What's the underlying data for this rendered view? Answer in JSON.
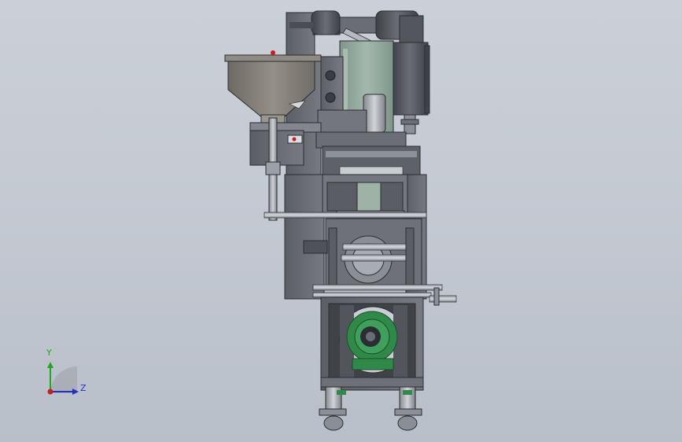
{
  "app": {
    "view": "cad-3d-viewport"
  },
  "triad": {
    "y_label": "Y",
    "z_label": "Z",
    "y_color": "#1ea81e",
    "z_color": "#2030c8",
    "x_color": "#c81e1e"
  },
  "colors": {
    "background": "#c4c9d2",
    "frame_dark": "#4e5258",
    "frame_mid": "#6b6f75",
    "frame_light": "#8a8f95",
    "green_glass": "#8fa69a",
    "green_gear": "#2f8a4a",
    "hopper": "#7d7a74",
    "indicator_red": "#c81e1e"
  },
  "model": {
    "name": "packaging-machine-assembly"
  }
}
